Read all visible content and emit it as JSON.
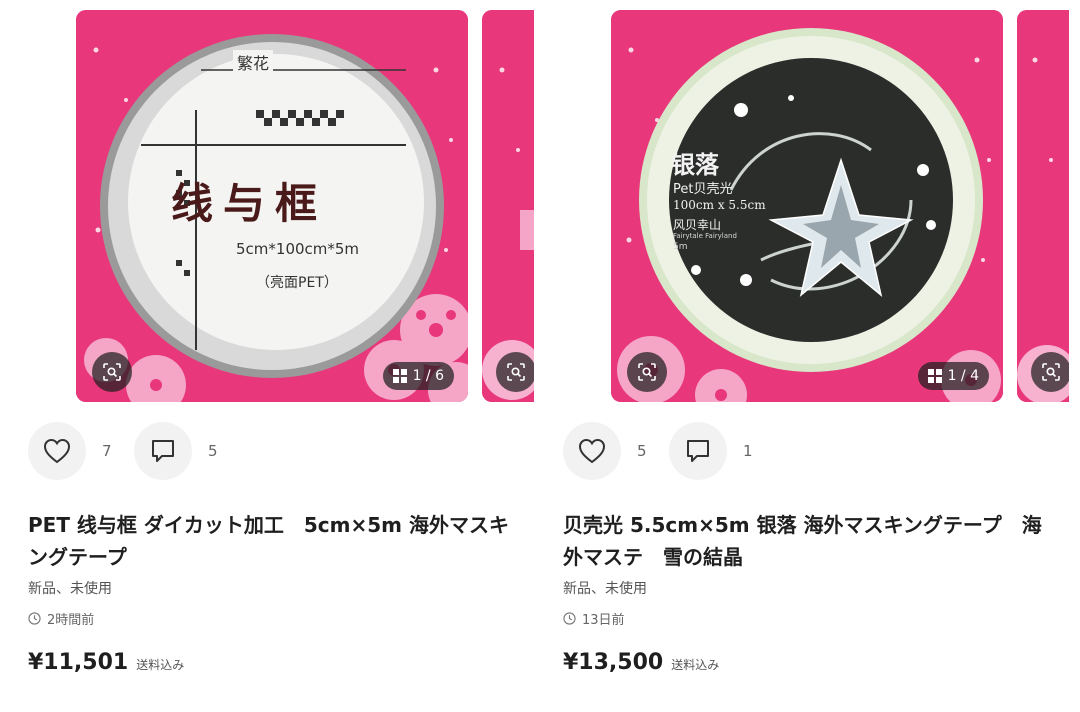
{
  "items": [
    {
      "counter": "1 / 6",
      "likes": "7",
      "comments": "5",
      "title": "PET 线与框 ダイカット加工　5cm×5m 海外マスキングテープ",
      "condition": "新品、未使用",
      "time": "2時間前",
      "price": "¥11,501",
      "shipping": "送料込み",
      "tape": {
        "label_top": "繁花",
        "label_main": "线与框",
        "label_size": "5cm*100cm*5m",
        "label_sub": "（亮面PET）"
      },
      "colors": {
        "background": "#e8377a",
        "tape_face": "#f4f4f2"
      }
    },
    {
      "counter": "1 / 4",
      "likes": "5",
      "comments": "1",
      "title": "贝壳光 5.5cm×5m 银落 海外マスキングテープ　海外マステ　雪の結晶",
      "condition": "新品、未使用",
      "time": "13日前",
      "price": "¥13,500",
      "shipping": "送料込み",
      "tape": {
        "label_main": "银落",
        "label_line1": "Pet贝壳光",
        "label_size": "100cm x 5.5cm",
        "label_brand": "风贝幸山",
        "label_brand_en": "Fairytale Fairyland",
        "label_len": "5m"
      },
      "colors": {
        "background": "#e8377a",
        "tape_face": "#2b2d2b"
      }
    }
  ],
  "icons": {
    "heart": "heart-icon",
    "comment": "comment-icon",
    "zoom": "image-search-icon",
    "gallery": "gallery-icon",
    "clock": "clock-icon"
  }
}
